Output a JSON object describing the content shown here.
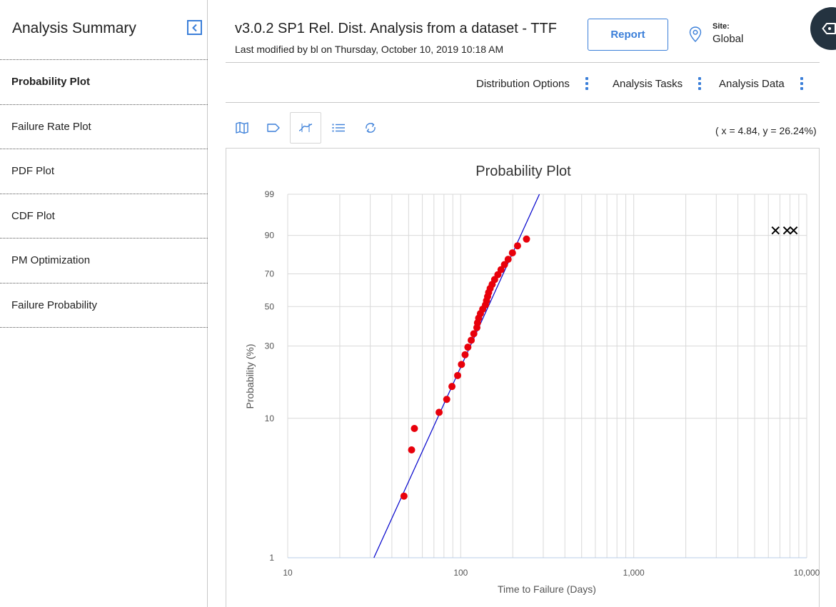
{
  "sidebar": {
    "title": "Analysis Summary",
    "items": [
      {
        "label": "Probability Plot",
        "active": true
      },
      {
        "label": "Failure Rate Plot",
        "active": false
      },
      {
        "label": "PDF Plot",
        "active": false
      },
      {
        "label": "CDF Plot",
        "active": false
      },
      {
        "label": "PM Optimization",
        "active": false
      },
      {
        "label": "Failure Probability",
        "active": false
      }
    ]
  },
  "header": {
    "title": "v3.0.2 SP1 Rel. Dist. Analysis from a dataset - TTF",
    "subtitle": "Last modified by bl on Thursday, October 10, 2019 10:18 AM",
    "report_label": "Report",
    "site_label": "Site:",
    "site_value": "Global"
  },
  "menus": [
    {
      "label": "Distribution Options"
    },
    {
      "label": "Analysis Tasks"
    },
    {
      "label": "Analysis Data"
    }
  ],
  "toolbar": {
    "tools": [
      {
        "icon": "map-icon",
        "active": false
      },
      {
        "icon": "tag-icon",
        "active": false
      },
      {
        "icon": "curve-fit-icon",
        "active": true
      },
      {
        "icon": "list-icon",
        "active": false
      },
      {
        "icon": "refresh-icon",
        "active": false
      }
    ],
    "coord_readout": "( x = 4.84, y = 26.24%)"
  },
  "colors": {
    "accent": "#3b7fd9",
    "point": "#e8000b",
    "fit_line": "#0000cc",
    "grid": "#d9d9d9",
    "fab": "#243340"
  },
  "chart_data": {
    "type": "scatter",
    "title": "Probability Plot",
    "xlabel": "Time to Failure (Days)",
    "ylabel": "Probability (%)",
    "x_scale": "log",
    "y_scale": "weibull-probability",
    "xlim": [
      10,
      10000
    ],
    "ylim": [
      1,
      99
    ],
    "x_ticks": [
      {
        "v": 10,
        "label": "10"
      },
      {
        "v": 100,
        "label": "100"
      },
      {
        "v": 1000,
        "label": "1,000"
      },
      {
        "v": 10000,
        "label": "10,000"
      }
    ],
    "y_ticks": [
      {
        "v": 1,
        "label": "1"
      },
      {
        "v": 10,
        "label": "10"
      },
      {
        "v": 30,
        "label": "30"
      },
      {
        "v": 50,
        "label": "50"
      },
      {
        "v": 70,
        "label": "70"
      },
      {
        "v": 90,
        "label": "90"
      },
      {
        "v": 99,
        "label": "99"
      }
    ],
    "grid": true,
    "failures": [
      {
        "x": 47,
        "y": 2.8
      },
      {
        "x": 52,
        "y": 6.0
      },
      {
        "x": 54,
        "y": 8.5
      },
      {
        "x": 75,
        "y": 11.0
      },
      {
        "x": 83,
        "y": 13.5
      },
      {
        "x": 89,
        "y": 16.5
      },
      {
        "x": 96,
        "y": 19.5
      },
      {
        "x": 101,
        "y": 23.0
      },
      {
        "x": 106,
        "y": 26.5
      },
      {
        "x": 110,
        "y": 29.5
      },
      {
        "x": 115,
        "y": 32.5
      },
      {
        "x": 119,
        "y": 35.5
      },
      {
        "x": 124,
        "y": 38.5
      },
      {
        "x": 125,
        "y": 41.0
      },
      {
        "x": 127,
        "y": 43.5
      },
      {
        "x": 130,
        "y": 46.0
      },
      {
        "x": 134,
        "y": 48.5
      },
      {
        "x": 139,
        "y": 51.0
      },
      {
        "x": 141,
        "y": 53.5
      },
      {
        "x": 143,
        "y": 56.0
      },
      {
        "x": 145,
        "y": 58.5
      },
      {
        "x": 148,
        "y": 61.0
      },
      {
        "x": 152,
        "y": 63.5
      },
      {
        "x": 157,
        "y": 66.5
      },
      {
        "x": 164,
        "y": 69.5
      },
      {
        "x": 171,
        "y": 72.5
      },
      {
        "x": 179,
        "y": 75.5
      },
      {
        "x": 188,
        "y": 78.5
      },
      {
        "x": 199,
        "y": 82.0
      },
      {
        "x": 213,
        "y": 85.5
      },
      {
        "x": 240,
        "y": 88.5
      }
    ],
    "suspensions": [
      {
        "x": 6600,
        "y": 91.8
      },
      {
        "x": 7700,
        "y": 91.8
      },
      {
        "x": 8400,
        "y": 91.8
      }
    ],
    "fit_line": {
      "x": [
        31.5,
        285
      ],
      "y": [
        1,
        99
      ]
    }
  }
}
